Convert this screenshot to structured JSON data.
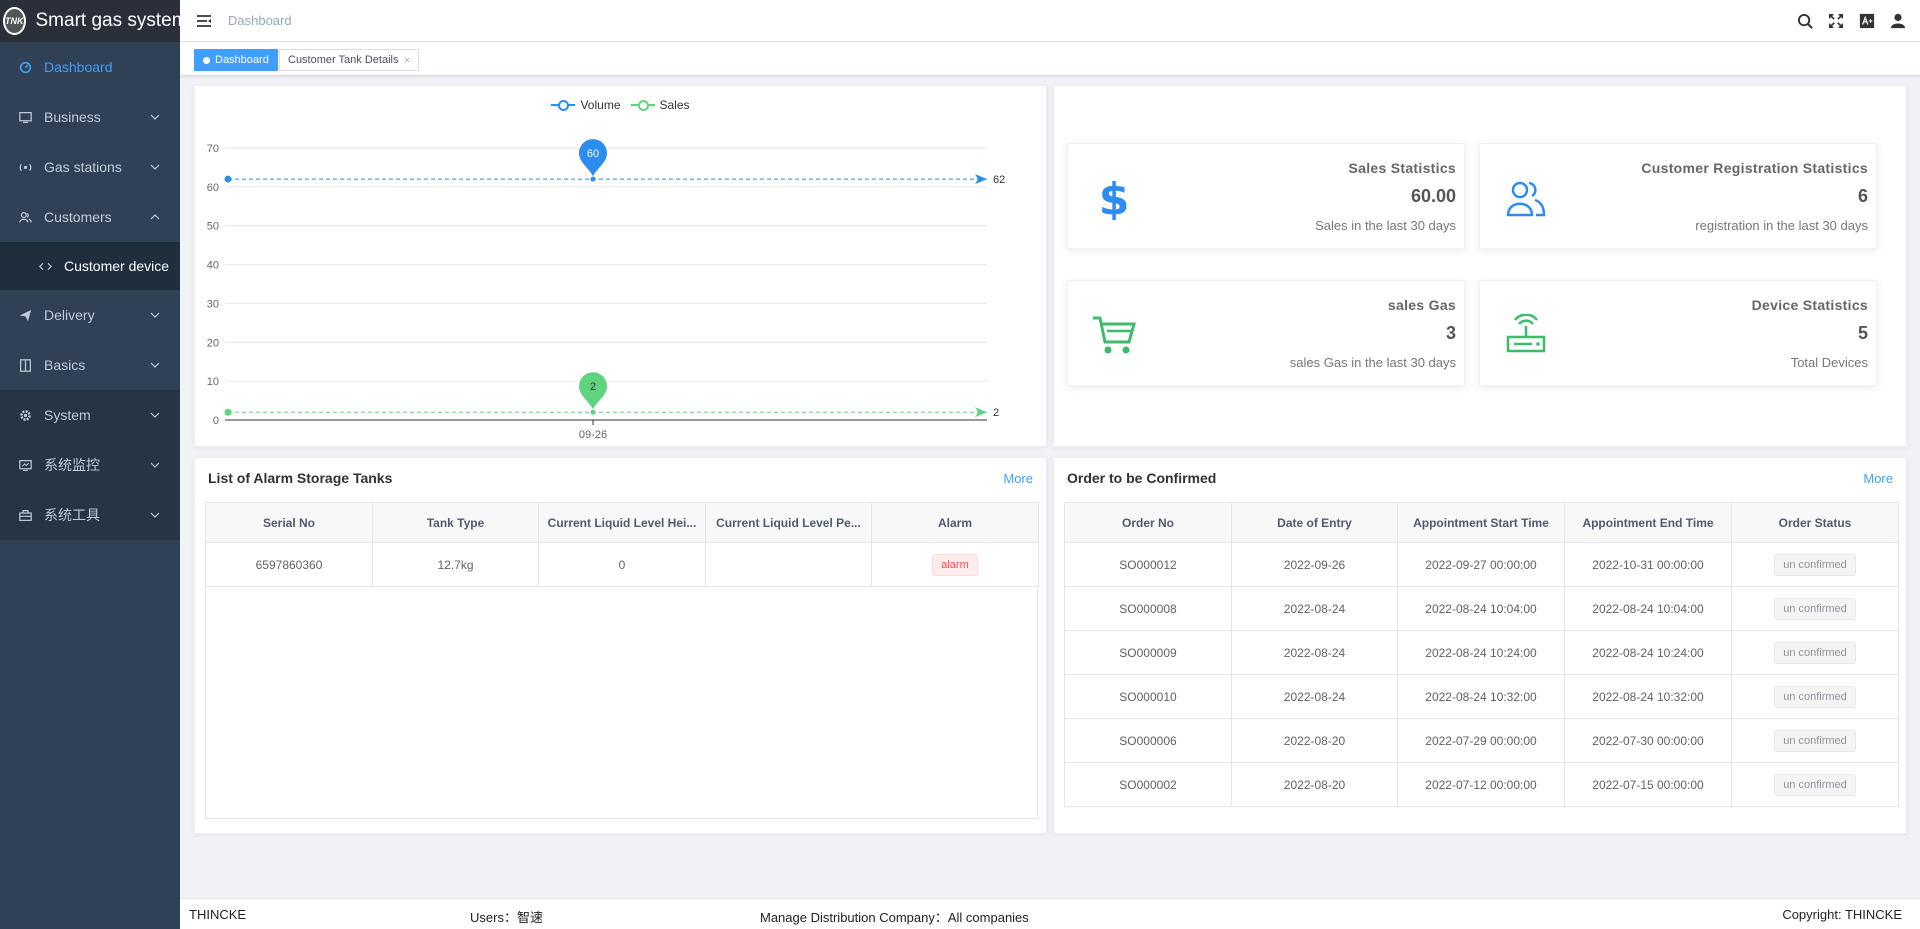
{
  "app": {
    "logo_badge": "TNK",
    "title": "Smart gas system"
  },
  "sidebar": {
    "items": [
      {
        "label": "Dashboard",
        "icon": "dashboard-icon"
      },
      {
        "label": "Business",
        "icon": "monitor-icon"
      },
      {
        "label": "Gas stations",
        "icon": "station-icon"
      },
      {
        "label": "Customers",
        "icon": "peoples-icon"
      },
      {
        "label": "Customer device",
        "icon": "code-icon"
      },
      {
        "label": "Delivery",
        "icon": "send-icon"
      },
      {
        "label": "Basics",
        "icon": "book-icon"
      },
      {
        "label": "System",
        "icon": "gear-icon"
      },
      {
        "label": "系统监控",
        "icon": "monitor-chart-icon"
      },
      {
        "label": "系统工具",
        "icon": "toolbox-icon"
      }
    ]
  },
  "header": {
    "breadcrumb": "Dashboard"
  },
  "tags": [
    {
      "label": "Dashboard"
    },
    {
      "label": "Customer Tank Details",
      "close": "×"
    }
  ],
  "chart_data": {
    "type": "line",
    "categories": [
      "09-26"
    ],
    "series": [
      {
        "name": "Volume",
        "values": [
          62,
          62,
          62
        ],
        "max_label": "60",
        "end_label": "62",
        "color": "#2d8cf0"
      },
      {
        "name": "Sales",
        "values": [
          2,
          2,
          2
        ],
        "max_label": "2",
        "end_label": "2",
        "color": "#5fd47e"
      }
    ],
    "yticks": [
      0,
      10,
      20,
      30,
      40,
      50,
      60,
      70
    ],
    "ylim": [
      0,
      70
    ],
    "legend": "top-center",
    "grid": true
  },
  "stats": [
    {
      "title": "Sales Statistics",
      "value": "60.00",
      "sub": "Sales in the last 30 days",
      "icon": "dollar-icon",
      "color": "#2d8cf0"
    },
    {
      "title": "Customer Registration Statistics",
      "value": "6",
      "sub": "registration in the last 30 days",
      "icon": "people-icon",
      "color": "#2d8cf0"
    },
    {
      "title": "sales Gas",
      "value": "3",
      "sub": "sales Gas in the last 30 days",
      "icon": "shopping-cart-icon",
      "color": "#3cbc6a"
    },
    {
      "title": "Device Statistics",
      "value": "5",
      "sub": "Total Devices",
      "icon": "router-icon",
      "color": "#3cbc6a"
    }
  ],
  "alarm": {
    "title": "List of Alarm Storage Tanks",
    "more": "More",
    "columns": [
      "Serial No",
      "Tank Type",
      "Current Liquid Level Hei...",
      "Current Liquid Level Pe...",
      "Alarm"
    ],
    "rows": [
      {
        "serial": "6597860360",
        "type": "12.7kg",
        "height": "0",
        "percent": "",
        "alarm": "alarm"
      }
    ]
  },
  "orders": {
    "title": "Order to be Confirmed",
    "more": "More",
    "columns": [
      "Order No",
      "Date of Entry",
      "Appointment Start Time",
      "Appointment End Time",
      "Order Status"
    ],
    "rows": [
      {
        "no": "SO000012",
        "date": "2022-09-26",
        "start": "2022-09-27 00:00:00",
        "end": "2022-10-31 00:00:00",
        "status": "un confirmed"
      },
      {
        "no": "SO000008",
        "date": "2022-08-24",
        "start": "2022-08-24 10:04:00",
        "end": "2022-08-24 10:04:00",
        "status": "un confirmed"
      },
      {
        "no": "SO000009",
        "date": "2022-08-24",
        "start": "2022-08-24 10:24:00",
        "end": "2022-08-24 10:24:00",
        "status": "un confirmed"
      },
      {
        "no": "SO000010",
        "date": "2022-08-24",
        "start": "2022-08-24 10:32:00",
        "end": "2022-08-24 10:32:00",
        "status": "un confirmed"
      },
      {
        "no": "SO000006",
        "date": "2022-08-20",
        "start": "2022-07-29 00:00:00",
        "end": "2022-07-30 00:00:00",
        "status": "un confirmed"
      },
      {
        "no": "SO000002",
        "date": "2022-08-20",
        "start": "2022-07-12 00:00:00",
        "end": "2022-07-15 00:00:00",
        "status": "un confirmed"
      }
    ]
  },
  "footer": {
    "company": "THINCKE",
    "users": "Users：智速",
    "distribution": "Manage Distribution Company：All companies",
    "copyright": "Copyright: THINCKE"
  }
}
